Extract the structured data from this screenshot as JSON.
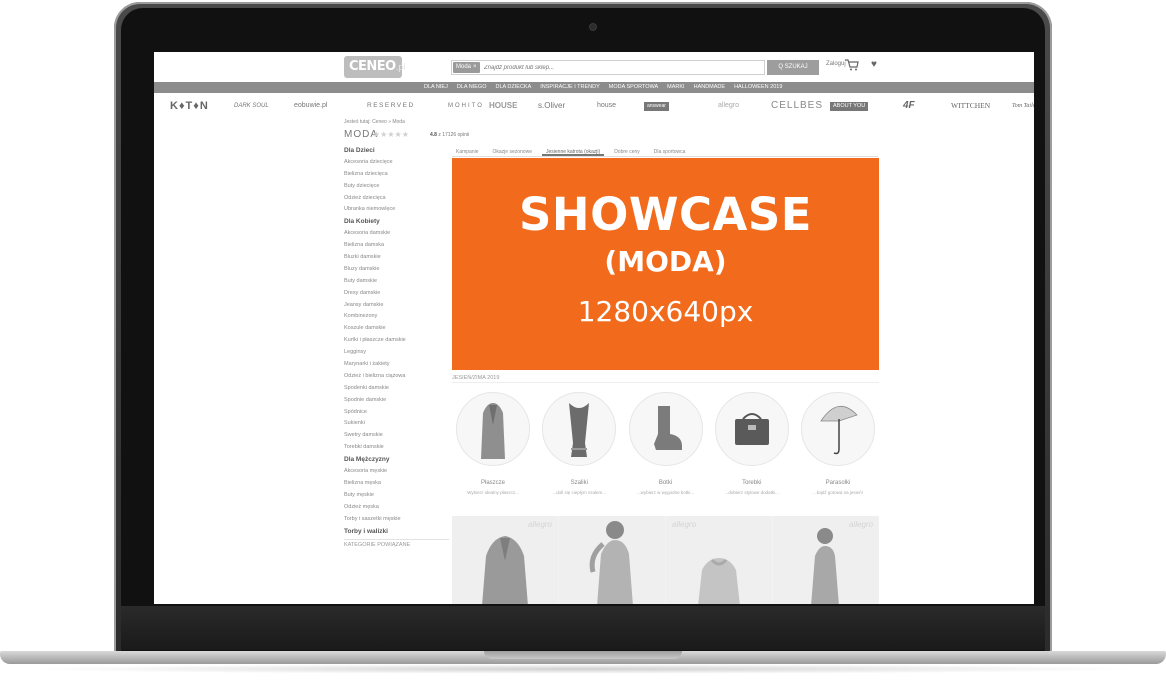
{
  "header": {
    "logo": "CENEO",
    "logo_tld": ".pl",
    "search_category": "Moda",
    "search_category_close": "×",
    "search_placeholder": "Znajdź produkt lub sklep...",
    "search_button": "Q SZUKAJ",
    "login": "Zaloguj"
  },
  "nav": {
    "items": [
      "DLA NIEJ",
      "DLA NIEGO",
      "DLA DZIECKA",
      "INSPIRACJE I TRENDY",
      "MODA SPORTOWA",
      "MARKI",
      "HANDMADE",
      "HALLOWEEN 2019"
    ]
  },
  "brands": {
    "items": [
      "K♦T♦N",
      "DARK SOUL",
      "eobuwie.pl",
      "RESERVED",
      "MOHITO",
      "HOUSE",
      "s.Oliver",
      "house",
      "answear",
      "allegro",
      "CELLBES",
      "ABOUT YOU",
      "4F",
      "WITTCHEN",
      "Tom Tailor"
    ]
  },
  "breadcrumb": "Jesteś tutaj: Ceneo » Moda",
  "page": {
    "title": "MODA",
    "stars": "★★★★★",
    "rating": "4.8",
    "rating_count": "z 17126 opinii"
  },
  "sidebar": {
    "sections": [
      {
        "heading": "Dla Dzieci",
        "items": [
          "Akcesoria dziecięce",
          "Bielizna dziecięca",
          "Buty dziecięce",
          "Odzież dziecięca",
          "Ubranka niemowlęce"
        ]
      },
      {
        "heading": "Dla Kobiety",
        "items": [
          "Akcesoria damskie",
          "Bielizna damska",
          "Bluzki damskie",
          "Bluzy damskie",
          "Buty damskie",
          "Dresy damskie",
          "Jeansy damskie",
          "Kombinezony",
          "Koszule damskie",
          "Kurtki i płaszcze damskie",
          "Legginsy",
          "Marynarki i żakiety",
          "Odzież i bielizna ciążowa",
          "Spodenki damskie",
          "Spodnie damskie",
          "Spódnice",
          "Sukienki",
          "Swetry damskie",
          "Torebki damskie"
        ]
      },
      {
        "heading": "Dla Mężczyzny",
        "items": [
          "Akcesoria męskie",
          "Bielizna męska",
          "Buty męskie",
          "Odzież męska",
          "Torby i saszetki męskie"
        ]
      },
      {
        "heading": "Torby i walizki",
        "items": []
      }
    ],
    "related": "KATEGORIE POWIĄZANE"
  },
  "tabs": [
    "Kampanie",
    "Okazje sezonowe",
    "Jesienne katrota (okazji)",
    "Dobre ceny",
    "Dla sportowca"
  ],
  "banner": {
    "line1": "SHOWCASE",
    "line2": "(MODA)",
    "line3": "1280x640px",
    "color": "#f26a1b"
  },
  "season_label": "JESIEŃ/ZIMA 2019",
  "categories": [
    {
      "name": "Płaszcze",
      "desc": "Wybierz idealny płaszcz..."
    },
    {
      "name": "Szaliki",
      "desc": "...doll się ciepłym szalem..."
    },
    {
      "name": "Botki",
      "desc": "...wybierz w wygodne botki..."
    },
    {
      "name": "Torebki",
      "desc": "...dobierz stylowe dodatki..."
    },
    {
      "name": "Parasolki",
      "desc": "...bądź gotowa na jesień!"
    }
  ],
  "products": {
    "shop_tag": "allegro"
  }
}
